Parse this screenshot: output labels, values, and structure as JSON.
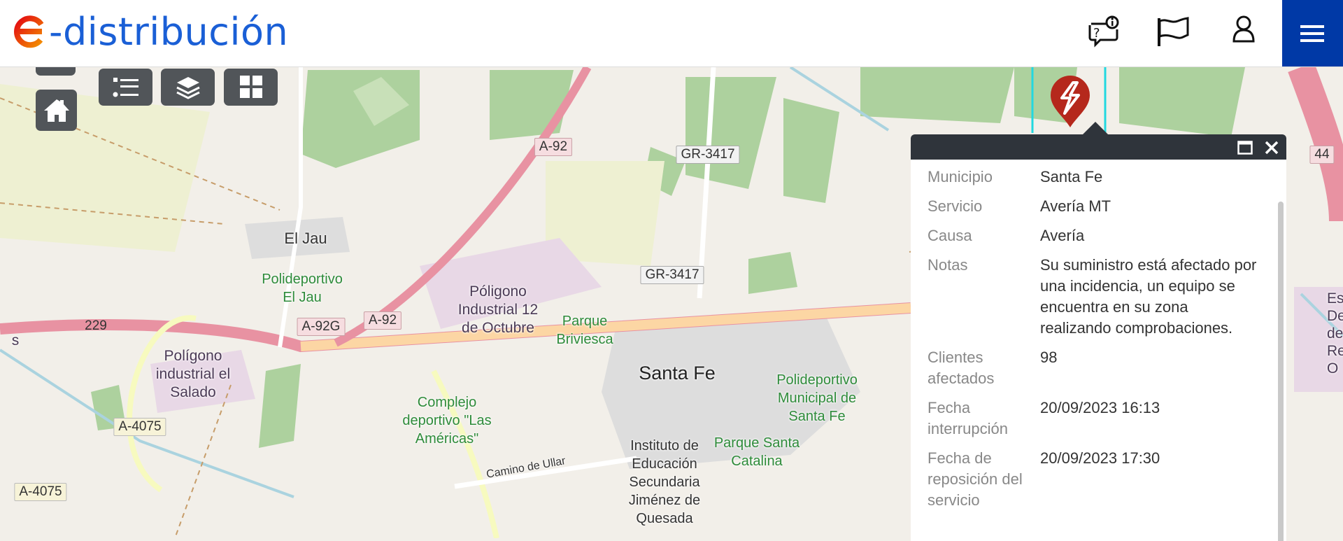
{
  "header": {
    "logo_text": "-distribución",
    "icons": [
      "help-info-icon",
      "flag-icon",
      "user-icon",
      "menu-icon"
    ],
    "accent": "#0039a6"
  },
  "map_controls": [
    "home-icon",
    "legend-list-icon",
    "layers-icon",
    "basemap-grid-icon"
  ],
  "map": {
    "places": [
      {
        "id": "el-jau",
        "text": "El Jau"
      },
      {
        "id": "polideportivo-el-jau",
        "text": "Polideportivo\nEl Jau"
      },
      {
        "id": "poligono-12-octubre",
        "text": "Póligono\nIndustrial 12\nde Octubre"
      },
      {
        "id": "parque-briviesca",
        "text": "Parque\nBriviesca"
      },
      {
        "id": "santa-fe",
        "text": "Santa Fe"
      },
      {
        "id": "polideportivo-municipal",
        "text": "Polideportivo\nMunicipal de\nSanta Fe"
      },
      {
        "id": "poligono-salado",
        "text": "Polígono\nindustrial el\nSalado"
      },
      {
        "id": "complejo-americas",
        "text": "Complejo\ndeportivo \"Las\nAméricas\""
      },
      {
        "id": "instituto",
        "text": "Instituto de\nEducación\nSecundaria\nJiménez de\nQuesada"
      },
      {
        "id": "parque-santa-catalina",
        "text": "Parque Santa\nCatalina"
      },
      {
        "id": "camino-ullar",
        "text": "Camino de Ullar"
      },
      {
        "id": "depuradora",
        "text": "Est\nDepu\nde A\nResi\nO"
      },
      {
        "id": "edge-s",
        "text": "s"
      }
    ],
    "roads": [
      "A-92",
      "GR-3417",
      "GR-3417",
      "A-92G",
      "A-92",
      "229",
      "A-4075",
      "A-4075",
      "44"
    ]
  },
  "popup": {
    "fields": [
      {
        "label": "Municipio",
        "value": "Santa Fe"
      },
      {
        "label": "Servicio",
        "value": "Avería MT"
      },
      {
        "label": "Causa",
        "value": "Avería"
      },
      {
        "label": "Notas",
        "value": "Su suministro está afectado por una incidencia, un equipo se encuentra en su zona realizando comprobaciones."
      },
      {
        "label": "Clientes afectados",
        "value": "98"
      },
      {
        "label": "Fecha interrupción",
        "value": "20/09/2023 16:13"
      },
      {
        "label": "Fecha de reposición del servicio",
        "value": "20/09/2023 17:30"
      }
    ]
  },
  "marker": {
    "icon": "outage-lightning-marker-icon",
    "color": "#b5281c"
  }
}
